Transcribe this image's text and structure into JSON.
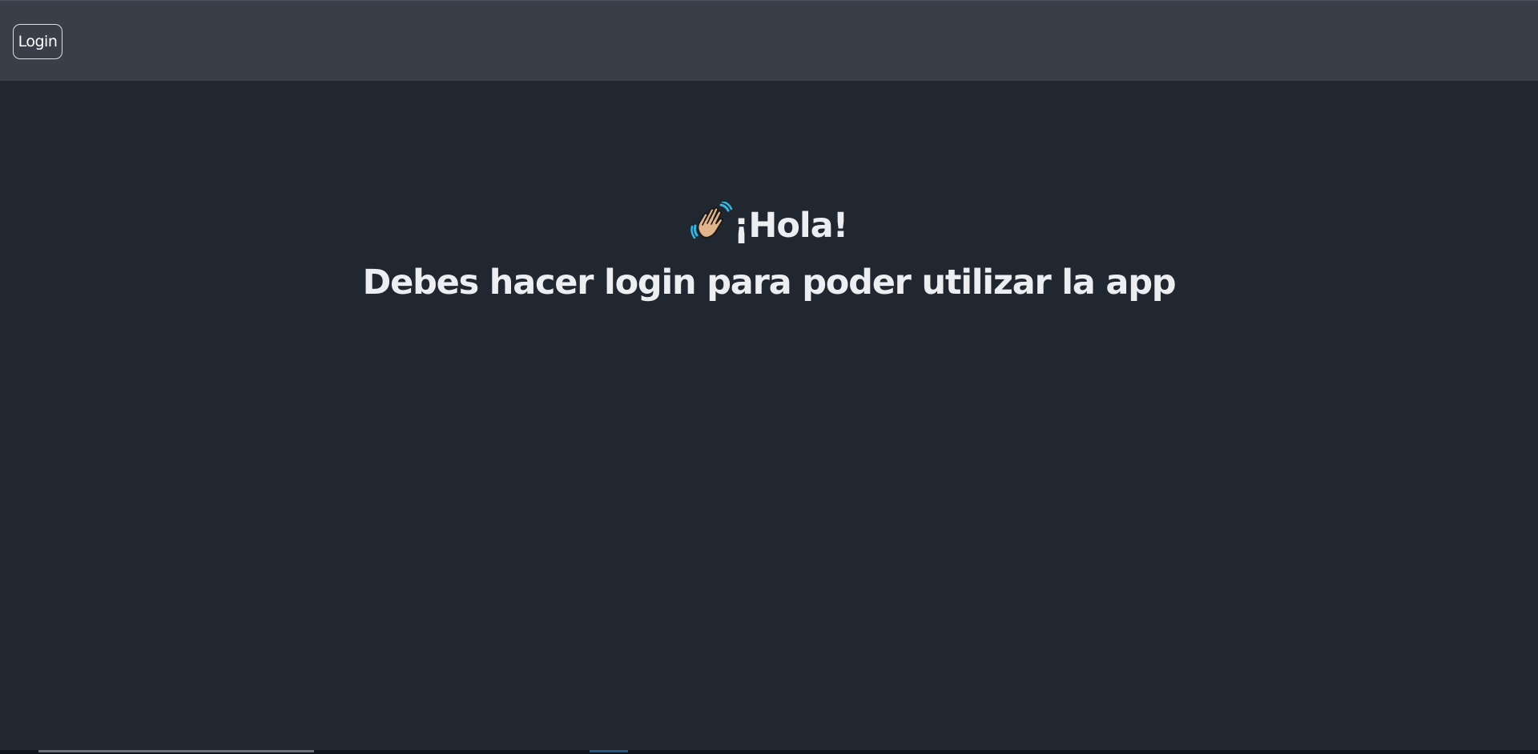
{
  "header": {
    "login_label": "Login"
  },
  "main": {
    "greeting": "¡Hola!",
    "greeting_icon": "waving-hand-icon",
    "message": "Debes hacer login para poder utilizar la app"
  },
  "colors": {
    "header_bg": "#3a3e48",
    "page_bg": "#212731",
    "text": "#eceef2",
    "button_border": "#d9dce2"
  }
}
